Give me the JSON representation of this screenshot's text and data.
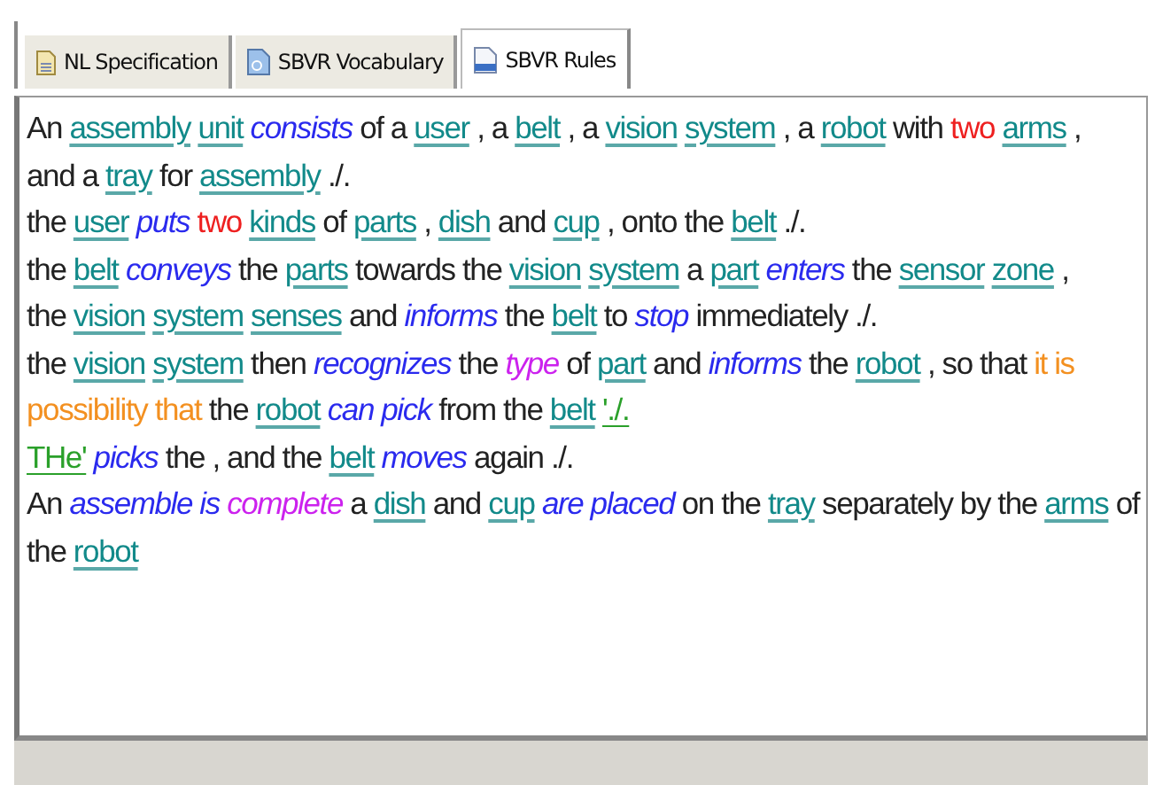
{
  "tabs": [
    {
      "label": "NL Specification",
      "kind": "document",
      "selected": false
    },
    {
      "label": "SBVR Vocabulary",
      "kind": "vocabulary",
      "selected": false
    },
    {
      "label": "SBVR Rules",
      "kind": "rules",
      "selected": true
    }
  ],
  "editor": {
    "lines": [
      [
        {
          "text": "An",
          "kind": "plain"
        },
        {
          "text": "assembly",
          "kind": "noun"
        },
        {
          "text": "unit",
          "kind": "noun"
        },
        {
          "text": "consists",
          "kind": "verb"
        },
        {
          "text": "of a",
          "kind": "plain"
        },
        {
          "text": "user",
          "kind": "noun"
        },
        {
          "text": ", a",
          "kind": "plain"
        },
        {
          "text": "belt",
          "kind": "noun"
        },
        {
          "text": ", a",
          "kind": "plain"
        },
        {
          "text": "vision",
          "kind": "noun"
        },
        {
          "text": "system",
          "kind": "noun"
        },
        {
          "text": ", a",
          "kind": "plain"
        },
        {
          "text": "robot",
          "kind": "noun"
        },
        {
          "text": "with",
          "kind": "plain"
        },
        {
          "text": "two",
          "kind": "quantity"
        },
        {
          "text": "arms",
          "kind": "noun"
        },
        {
          "text": ",",
          "kind": "plain"
        }
      ],
      [
        {
          "text": "and a",
          "kind": "plain"
        },
        {
          "text": "tray",
          "kind": "noun"
        },
        {
          "text": "for",
          "kind": "plain"
        },
        {
          "text": "assembly",
          "kind": "noun"
        },
        {
          "text": "./.",
          "kind": "plain"
        }
      ],
      [
        {
          "text": "the",
          "kind": "plain"
        },
        {
          "text": "user",
          "kind": "noun"
        },
        {
          "text": "puts",
          "kind": "verb"
        },
        {
          "text": "two",
          "kind": "quantity"
        },
        {
          "text": "kinds",
          "kind": "noun"
        },
        {
          "text": "of",
          "kind": "plain"
        },
        {
          "text": "parts",
          "kind": "noun"
        },
        {
          "text": ",",
          "kind": "plain"
        },
        {
          "text": "dish",
          "kind": "noun"
        },
        {
          "text": "and",
          "kind": "plain"
        },
        {
          "text": "cup",
          "kind": "noun"
        },
        {
          "text": ", onto the",
          "kind": "plain"
        },
        {
          "text": "belt",
          "kind": "noun"
        },
        {
          "text": "./.",
          "kind": "plain"
        }
      ],
      [
        {
          "text": "the",
          "kind": "plain"
        },
        {
          "text": "belt",
          "kind": "noun"
        },
        {
          "text": "conveys",
          "kind": "verb"
        },
        {
          "text": "the",
          "kind": "plain"
        },
        {
          "text": "parts",
          "kind": "noun"
        },
        {
          "text": "towards the",
          "kind": "plain"
        },
        {
          "text": "vision",
          "kind": "noun"
        },
        {
          "text": "system",
          "kind": "noun"
        },
        {
          "text": "a",
          "kind": "plain"
        },
        {
          "text": "part",
          "kind": "noun"
        },
        {
          "text": "enters",
          "kind": "verb"
        },
        {
          "text": "the",
          "kind": "plain"
        },
        {
          "text": "sensor",
          "kind": "noun"
        },
        {
          "text": "zone",
          "kind": "noun"
        },
        {
          "text": ",",
          "kind": "plain"
        }
      ],
      [
        {
          "text": "the",
          "kind": "plain"
        },
        {
          "text": "vision",
          "kind": "noun"
        },
        {
          "text": "system",
          "kind": "noun"
        },
        {
          "text": "senses",
          "kind": "noun"
        },
        {
          "text": "and",
          "kind": "plain"
        },
        {
          "text": "informs",
          "kind": "verb"
        },
        {
          "text": "the",
          "kind": "plain"
        },
        {
          "text": "belt",
          "kind": "noun"
        },
        {
          "text": "to",
          "kind": "plain"
        },
        {
          "text": "stop",
          "kind": "verb"
        },
        {
          "text": "immediately ./.",
          "kind": "plain"
        }
      ],
      [
        {
          "text": "the",
          "kind": "plain"
        },
        {
          "text": "vision",
          "kind": "noun"
        },
        {
          "text": "system",
          "kind": "noun"
        },
        {
          "text": "then",
          "kind": "plain"
        },
        {
          "text": "recognizes",
          "kind": "verb"
        },
        {
          "text": "the",
          "kind": "plain"
        },
        {
          "text": "type",
          "kind": "role"
        },
        {
          "text": "of",
          "kind": "plain"
        },
        {
          "text": "part",
          "kind": "noun"
        },
        {
          "text": "and",
          "kind": "plain"
        },
        {
          "text": "informs",
          "kind": "verb"
        },
        {
          "text": "the",
          "kind": "plain"
        },
        {
          "text": "robot",
          "kind": "noun"
        },
        {
          "text": ", so that",
          "kind": "plain"
        },
        {
          "text": "it is",
          "kind": "modal"
        }
      ],
      [
        {
          "text": "possibility that",
          "kind": "modal"
        },
        {
          "text": "the",
          "kind": "plain"
        },
        {
          "text": "robot",
          "kind": "noun"
        },
        {
          "text": "can pick",
          "kind": "verb"
        },
        {
          "text": "from the",
          "kind": "plain"
        },
        {
          "text": "belt",
          "kind": "noun"
        },
        {
          "text": "'./.",
          "kind": "error"
        }
      ],
      [
        {
          "text": "THe'",
          "kind": "error"
        },
        {
          "text": "picks",
          "kind": "verb"
        },
        {
          "text": "the , and the",
          "kind": "plain"
        },
        {
          "text": "belt",
          "kind": "noun"
        },
        {
          "text": "moves",
          "kind": "verb"
        },
        {
          "text": "again ./.",
          "kind": "plain"
        }
      ],
      [
        {
          "text": "An",
          "kind": "plain"
        },
        {
          "text": "assemble is",
          "kind": "verb"
        },
        {
          "text": "complete",
          "kind": "role"
        },
        {
          "text": "a",
          "kind": "plain"
        },
        {
          "text": "dish",
          "kind": "noun"
        },
        {
          "text": "and",
          "kind": "plain"
        },
        {
          "text": "cup",
          "kind": "noun"
        },
        {
          "text": "are placed",
          "kind": "verb"
        },
        {
          "text": "on the",
          "kind": "plain"
        },
        {
          "text": "tray",
          "kind": "noun"
        },
        {
          "text": "separately by the",
          "kind": "plain"
        },
        {
          "text": "arms",
          "kind": "noun"
        },
        {
          "text": "of",
          "kind": "plain"
        }
      ],
      [
        {
          "text": "the",
          "kind": "plain"
        },
        {
          "text": "robot",
          "kind": "noun"
        }
      ]
    ]
  }
}
